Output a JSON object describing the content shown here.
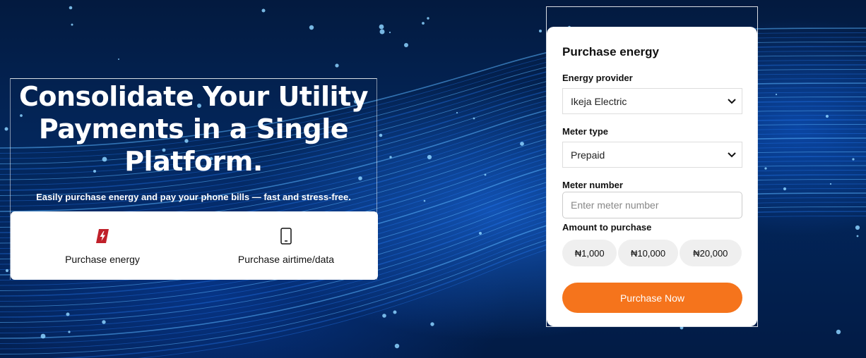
{
  "hero": {
    "title": "Consolidate Your Utility Payments in a Single Platform.",
    "subtitle": "Easily purchase energy and pay your phone bills — fast and stress-free."
  },
  "tabs": [
    {
      "label": "Purchase energy",
      "icon": "lightning-icon",
      "color": "#c0202a"
    },
    {
      "label": "Purchase airtime/data",
      "icon": "phone-icon"
    }
  ],
  "form": {
    "title": "Purchase energy",
    "provider_label": "Energy provider",
    "provider_value": "Ikeja Electric",
    "meter_type_label": "Meter type",
    "meter_type_value": "Prepaid",
    "meter_number_label": "Meter number",
    "meter_number_placeholder": "Enter meter number",
    "amount_label": "Amount to purchase",
    "amounts": [
      "₦1,000",
      "₦10,000",
      "₦20,000"
    ],
    "submit_label": "Purchase Now",
    "accent_color": "#f5741c"
  }
}
